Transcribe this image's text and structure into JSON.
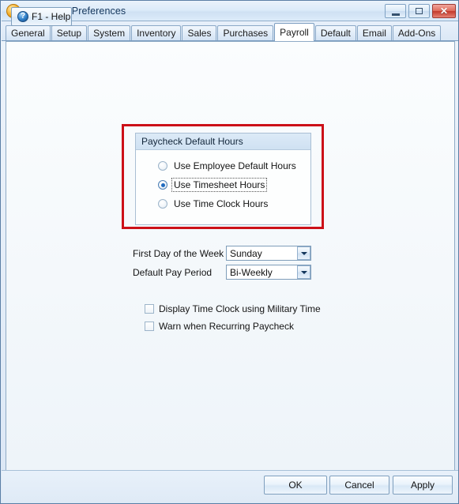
{
  "window": {
    "title": "Company Preferences",
    "icon": "app-orb-icon",
    "controls": {
      "minimize": "minimize-icon",
      "maximize": "maximize-icon",
      "close": "✕"
    }
  },
  "tabs": [
    {
      "label": "General",
      "active": false
    },
    {
      "label": "Setup",
      "active": false
    },
    {
      "label": "System",
      "active": false
    },
    {
      "label": "Inventory",
      "active": false
    },
    {
      "label": "Sales",
      "active": false
    },
    {
      "label": "Purchases",
      "active": false
    },
    {
      "label": "Payroll",
      "active": true
    },
    {
      "label": "Default",
      "active": false
    },
    {
      "label": "Email",
      "active": false
    },
    {
      "label": "Add-Ons",
      "active": false
    }
  ],
  "annotation": {
    "color": "#cc1018",
    "shape": "rectangle-highlight"
  },
  "groupbox": {
    "title": "Paycheck Default Hours",
    "radios": [
      {
        "label": "Use Employee Default Hours",
        "selected": false,
        "focused": false
      },
      {
        "label": "Use Timesheet Hours",
        "selected": true,
        "focused": true
      },
      {
        "label": "Use Time Clock Hours",
        "selected": false,
        "focused": false
      }
    ]
  },
  "fields": [
    {
      "label": "First Day of the Week",
      "value": "Sunday",
      "icon": "chevron-down-icon"
    },
    {
      "label": "Default Pay Period",
      "value": "Bi-Weekly",
      "icon": "chevron-down-icon"
    }
  ],
  "checkboxes": [
    {
      "label": "Display Time Clock using Military Time",
      "checked": false
    },
    {
      "label": "Warn when Recurring Paycheck",
      "checked": false
    }
  ],
  "footer": {
    "help_label": "F1 - Help",
    "help_icon_glyph": "?",
    "ok_label": "OK",
    "cancel_label": "Cancel",
    "apply_label": "Apply"
  }
}
